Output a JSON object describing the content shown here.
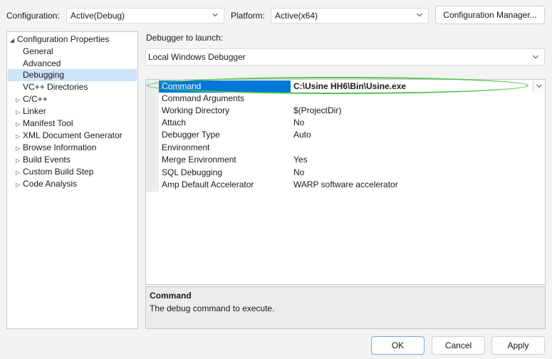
{
  "toolbar": {
    "configuration_label": "Configuration:",
    "configuration_value": "Active(Debug)",
    "platform_label": "Platform:",
    "platform_value": "Active(x64)",
    "configuration_manager_label": "Configuration Manager..."
  },
  "tree": {
    "root_label": "Configuration Properties",
    "items": [
      {
        "label": "General",
        "expandable": false
      },
      {
        "label": "Advanced",
        "expandable": false
      },
      {
        "label": "Debugging",
        "expandable": false,
        "selected": true
      },
      {
        "label": "VC++ Directories",
        "expandable": false
      },
      {
        "label": "C/C++",
        "expandable": true
      },
      {
        "label": "Linker",
        "expandable": true
      },
      {
        "label": "Manifest Tool",
        "expandable": true
      },
      {
        "label": "XML Document Generator",
        "expandable": true
      },
      {
        "label": "Browse Information",
        "expandable": true
      },
      {
        "label": "Build Events",
        "expandable": true
      },
      {
        "label": "Custom Build Step",
        "expandable": true
      },
      {
        "label": "Code Analysis",
        "expandable": true
      }
    ]
  },
  "debugger": {
    "label": "Debugger to launch:",
    "value": "Local Windows Debugger"
  },
  "properties": [
    {
      "name": "Command",
      "value": "C:\\Usine HH6\\Bin\\Usine.exe",
      "selected": true
    },
    {
      "name": "Command Arguments",
      "value": ""
    },
    {
      "name": "Working Directory",
      "value": "$(ProjectDir)"
    },
    {
      "name": "Attach",
      "value": "No"
    },
    {
      "name": "Debugger Type",
      "value": "Auto"
    },
    {
      "name": "Environment",
      "value": ""
    },
    {
      "name": "Merge Environment",
      "value": "Yes"
    },
    {
      "name": "SQL Debugging",
      "value": "No"
    },
    {
      "name": "Amp Default Accelerator",
      "value": "WARP software accelerator"
    }
  ],
  "description": {
    "title": "Command",
    "text": "The debug command to execute."
  },
  "buttons": {
    "ok": "OK",
    "cancel": "Cancel",
    "apply": "Apply"
  },
  "colors": {
    "selection": "#0078d7",
    "tree_selection": "#cce4f7",
    "highlight_ring": "#52c452"
  }
}
